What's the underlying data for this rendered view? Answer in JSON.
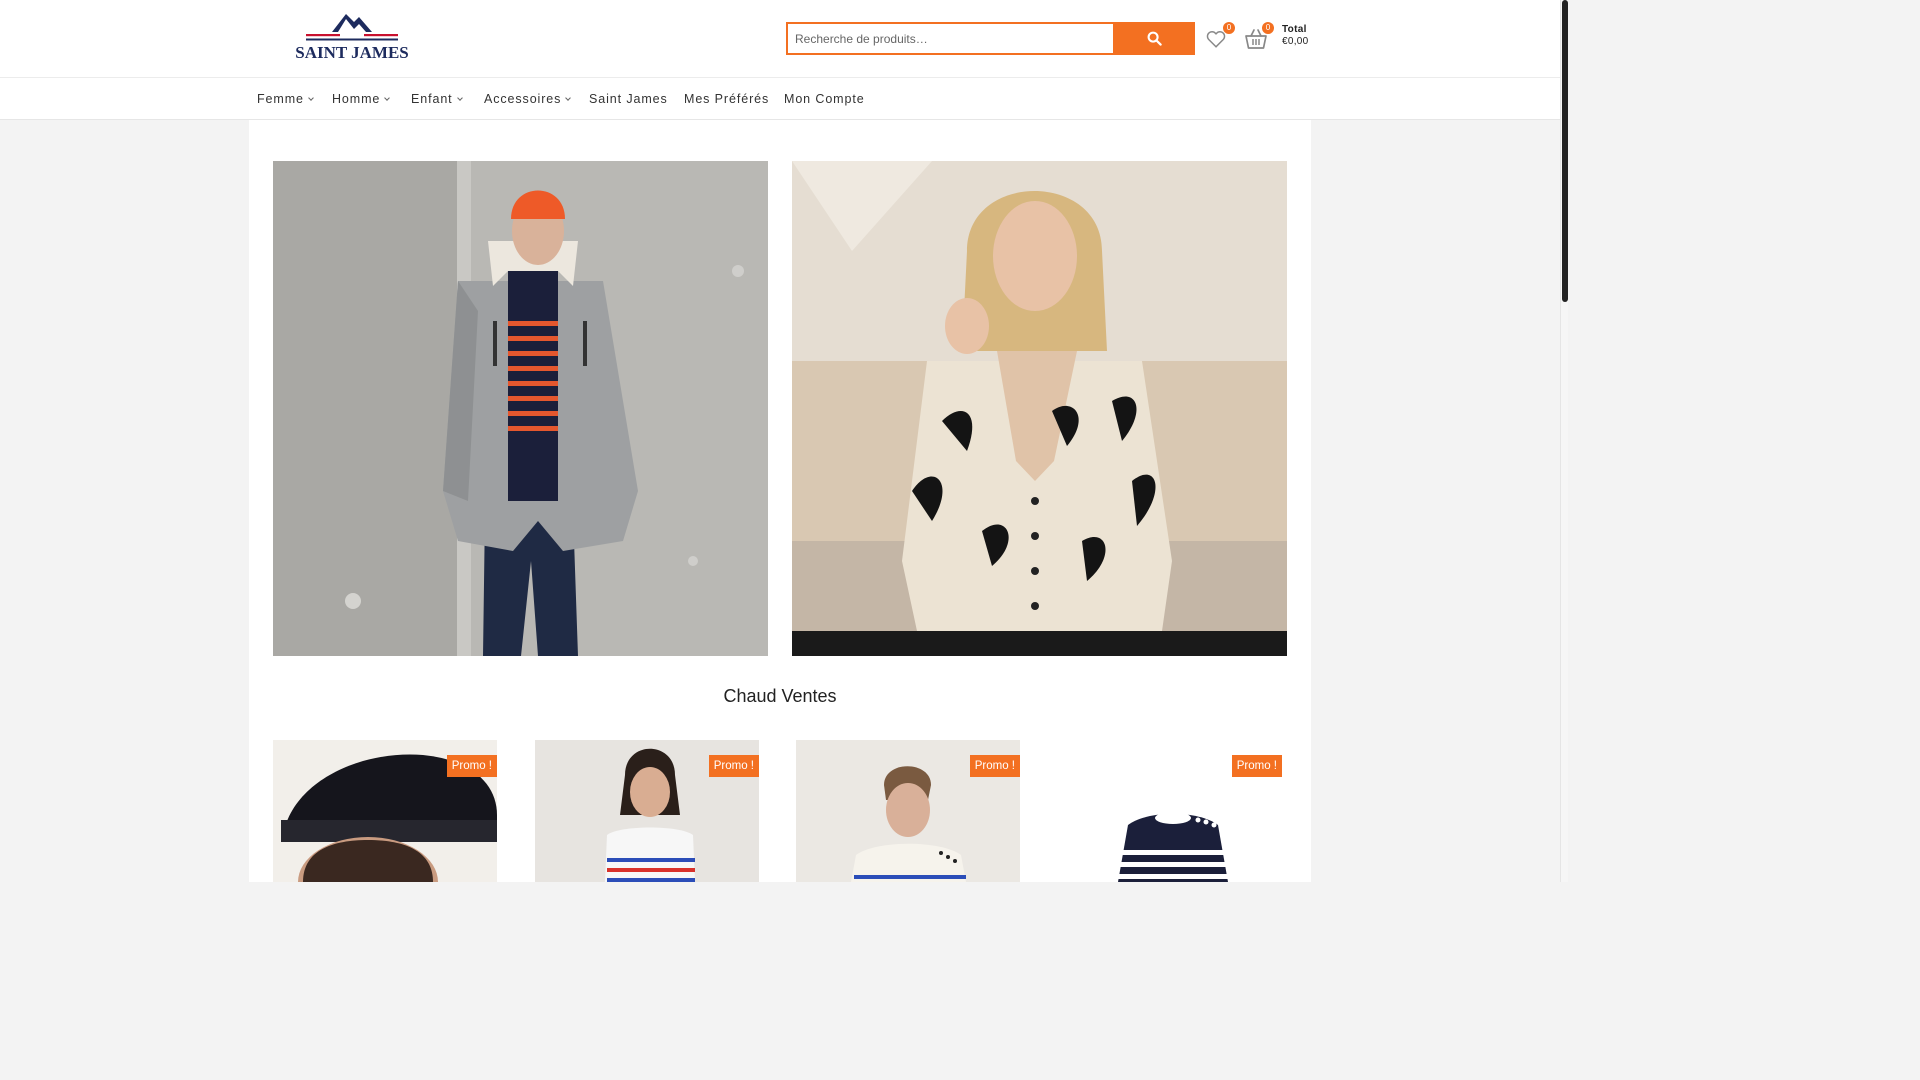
{
  "brand": {
    "name": "SAINT JAMES"
  },
  "search": {
    "placeholder": "Recherche de produits…",
    "button_icon": "search-icon"
  },
  "wishlist": {
    "count": "0",
    "icon": "heart-icon"
  },
  "cart": {
    "count": "0",
    "total_label": "Total",
    "total_value": "€0,00",
    "icon": "basket-icon"
  },
  "nav": {
    "items": [
      {
        "label": "Femme",
        "has_dropdown": true
      },
      {
        "label": "Homme",
        "has_dropdown": true
      },
      {
        "label": "Enfant",
        "has_dropdown": true
      },
      {
        "label": "Accessoires",
        "has_dropdown": true
      },
      {
        "label": "Saint James",
        "has_dropdown": false
      },
      {
        "label": "Mes Préférés",
        "has_dropdown": false
      },
      {
        "label": "Mon Compte",
        "has_dropdown": false
      }
    ]
  },
  "section": {
    "title": "Chaud Ventes"
  },
  "products": [
    {
      "badge": "Promo !"
    },
    {
      "badge": "Promo !"
    },
    {
      "badge": "Promo !"
    },
    {
      "badge": "Promo !"
    }
  ],
  "colors": {
    "accent": "#f37021",
    "brand_navy": "#1d2b5e",
    "brand_red": "#c8102e"
  }
}
